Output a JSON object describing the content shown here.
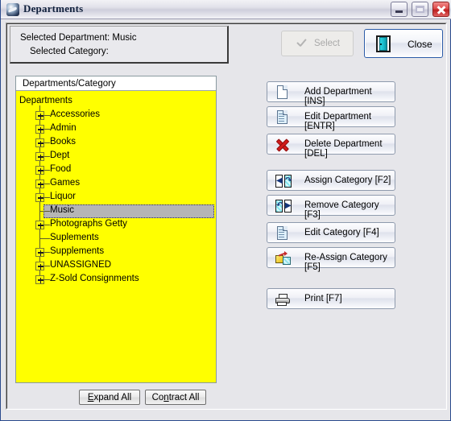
{
  "window": {
    "title": "Departments",
    "icon": "app-icon",
    "controls": {
      "minimize": "minimize-icon",
      "maximize": "maximize-icon",
      "close": "close-icon"
    }
  },
  "info_panel": {
    "selected_department_line": "Selected Department: Music",
    "selected_category_line": "Selected Category:",
    "selected_department": "Music",
    "selected_category": ""
  },
  "top_actions": [
    {
      "id": "select",
      "label": "Select",
      "icon": "check-icon",
      "enabled": false
    },
    {
      "id": "close",
      "label": "Close",
      "icon": "door-exit-icon",
      "enabled": true,
      "focused": true
    }
  ],
  "tree": {
    "header": "Departments/Category",
    "background_color": "#ffff00",
    "selection_color": "#b5b5b5",
    "nodes": [
      {
        "label": "Departments",
        "level": 0,
        "expandable": false,
        "expanded": true,
        "selected": false
      },
      {
        "label": "Accessories",
        "level": 1,
        "expandable": true,
        "expanded": false,
        "selected": false
      },
      {
        "label": "Admin",
        "level": 1,
        "expandable": true,
        "expanded": false,
        "selected": false
      },
      {
        "label": "Books",
        "level": 1,
        "expandable": true,
        "expanded": false,
        "selected": false
      },
      {
        "label": "Dept",
        "level": 1,
        "expandable": true,
        "expanded": false,
        "selected": false
      },
      {
        "label": "Food",
        "level": 1,
        "expandable": true,
        "expanded": false,
        "selected": false
      },
      {
        "label": "Games",
        "level": 1,
        "expandable": true,
        "expanded": false,
        "selected": false
      },
      {
        "label": "Liquor",
        "level": 1,
        "expandable": true,
        "expanded": false,
        "selected": false
      },
      {
        "label": "Music",
        "level": 1,
        "expandable": false,
        "expanded": false,
        "selected": true
      },
      {
        "label": "Photographs Getty",
        "level": 1,
        "expandable": true,
        "expanded": false,
        "selected": false
      },
      {
        "label": "Suplements",
        "level": 1,
        "expandable": false,
        "expanded": false,
        "selected": false
      },
      {
        "label": "Supplements",
        "level": 1,
        "expandable": true,
        "expanded": false,
        "selected": false
      },
      {
        "label": "UNASSIGNED",
        "level": 1,
        "expandable": true,
        "expanded": false,
        "selected": false
      },
      {
        "label": "Z-Sold Consignments",
        "level": 1,
        "expandable": true,
        "expanded": false,
        "selected": false
      }
    ]
  },
  "side_actions": [
    {
      "id": "add-department",
      "label": "Add Department [INS]",
      "icon": "new-page-icon"
    },
    {
      "id": "edit-department",
      "label": "Edit Department [ENTR]",
      "icon": "edit-page-icon"
    },
    {
      "id": "delete-department",
      "label": "Delete Department [DEL]",
      "icon": "red-x-icon"
    },
    {
      "id": "assign-category",
      "label": "Assign Category [F2]",
      "icon": "assign-arrow-icon"
    },
    {
      "id": "remove-category",
      "label": "Remove Category [F3]",
      "icon": "remove-arrow-icon"
    },
    {
      "id": "edit-category",
      "label": "Edit Category [F4]",
      "icon": "edit-page-icon"
    },
    {
      "id": "reassign-category",
      "label": "Re-Assign Category [F5]",
      "icon": "cubes-arrow-icon"
    },
    {
      "id": "print",
      "label": "Print [F7]",
      "icon": "printer-icon"
    }
  ],
  "bottom_actions": {
    "expand_all": {
      "label": "Expand All",
      "accelerator": "E"
    },
    "contract_all": {
      "label": "Contract All",
      "accelerator": "n"
    }
  }
}
